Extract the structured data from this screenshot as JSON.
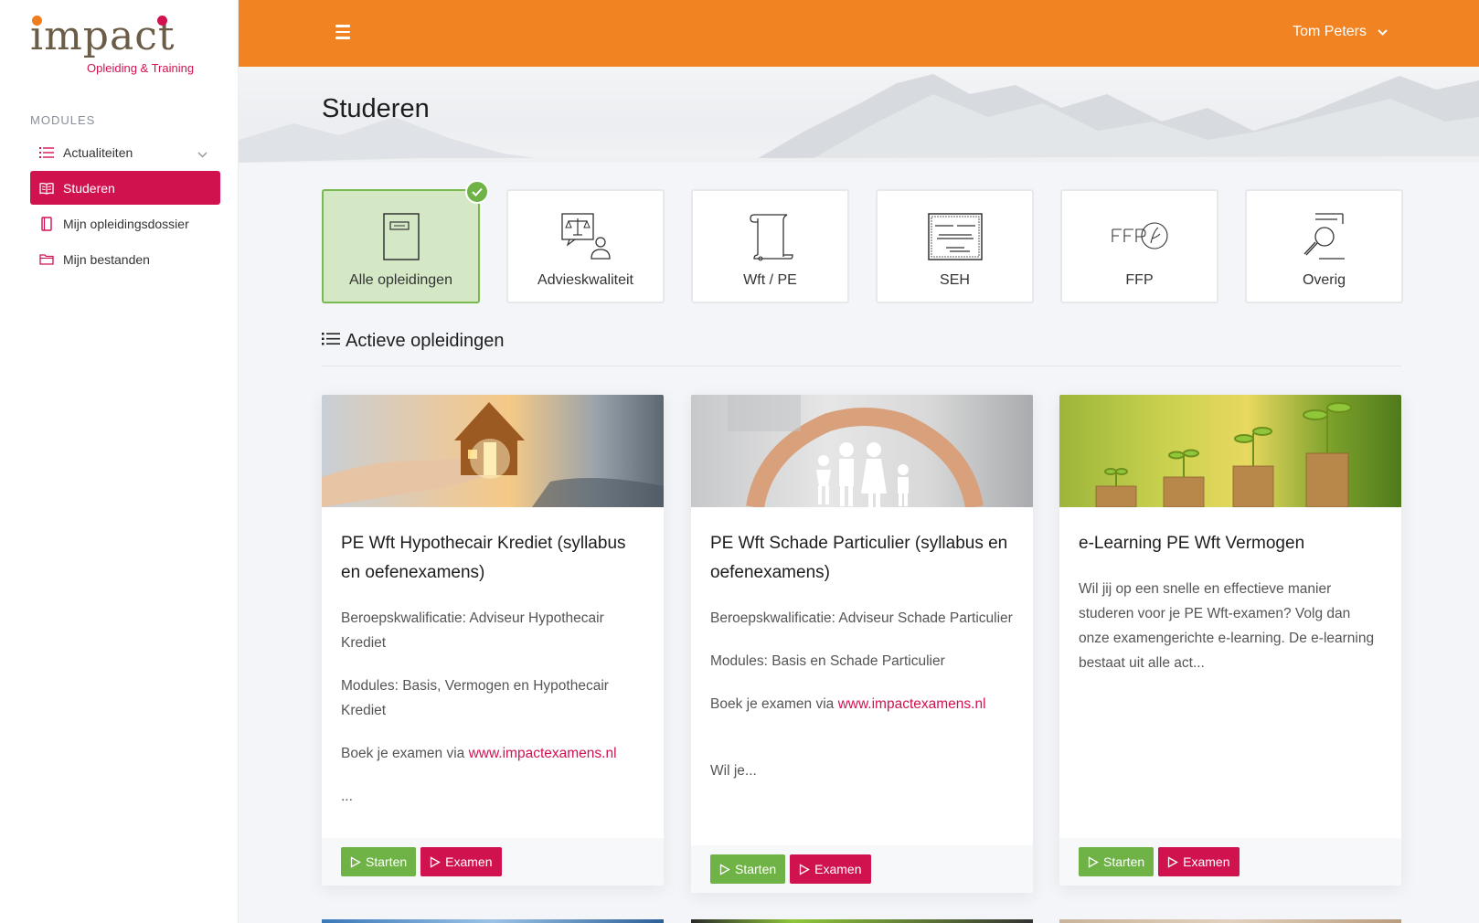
{
  "brand": {
    "name": "impact",
    "tagline": "Opleiding & Training"
  },
  "sidebar": {
    "heading": "MODULES",
    "items": [
      {
        "label": "Actualiteiten",
        "icon": "list-icon",
        "expandable": true
      },
      {
        "label": "Studeren",
        "icon": "book-icon",
        "active": true
      },
      {
        "label": "Mijn opleidingsdossier",
        "icon": "bookmark-icon"
      },
      {
        "label": "Mijn bestanden",
        "icon": "folder-icon"
      }
    ]
  },
  "topbar": {
    "user_name": "Tom Peters"
  },
  "page": {
    "title": "Studeren"
  },
  "categories": [
    {
      "label": "Alle opleidingen",
      "icon": "document-icon",
      "selected": true
    },
    {
      "label": "Advieskwaliteit",
      "icon": "advice-scale-icon"
    },
    {
      "label": "Wft / PE",
      "icon": "scroll-icon"
    },
    {
      "label": "SEH",
      "icon": "certificate-icon"
    },
    {
      "label": "FFP",
      "icon": "ffp-logo-icon"
    },
    {
      "label": "Overig",
      "icon": "magnifier-doc-icon"
    }
  ],
  "section": {
    "title": "Actieve opleidingen"
  },
  "courses": [
    {
      "title": "PE Wft Hypothecair Krediet (syllabus en oefenexamens)",
      "paragraphs": [
        "Beroepskwalificatie: Adviseur Hypothecair Krediet",
        "Modules: Basis, Vermogen en Hypothecair Krediet"
      ],
      "book_prefix": "Boek je examen via ",
      "book_link": "www.impactexamens.nl",
      "tail": "...",
      "start_label": "Starten",
      "exam_label": "Examen"
    },
    {
      "title": "PE Wft Schade Particulier (syllabus en oefenexamens)",
      "paragraphs": [
        "Beroepskwalificatie: Adviseur Schade Particulier",
        "Modules: Basis en Schade Particulier"
      ],
      "book_prefix": "Boek je examen via ",
      "book_link": "www.impactexamens.nl",
      "tail": "Wil je...",
      "start_label": "Starten",
      "exam_label": "Examen"
    },
    {
      "title": "e-Learning PE Wft Vermogen",
      "paragraphs": [
        "Wil jij op een snelle en effectieve manier studeren voor je PE Wft-examen? Volg dan onze examengerichte e-learning. De e-learning bestaat uit alle act..."
      ],
      "start_label": "Starten",
      "exam_label": "Examen"
    }
  ],
  "colors": {
    "brand_orange": "#f28322",
    "brand_magenta": "#d0134f",
    "success_green": "#6fb246",
    "selected_tile_bg": "#d4e8c6"
  }
}
